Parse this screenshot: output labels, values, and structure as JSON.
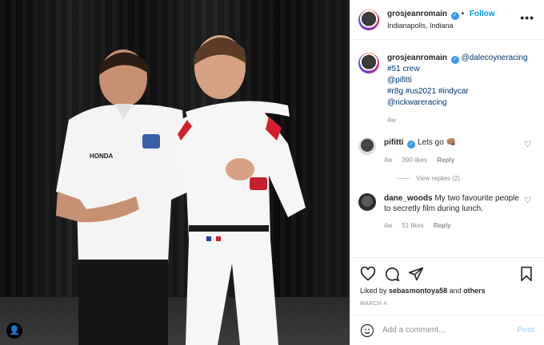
{
  "post": {
    "author": "grosjeanromain",
    "follow_label": "Follow",
    "location": "Indianapolis, Indiana",
    "more_label": "•••"
  },
  "caption": {
    "author": "grosjeanromain",
    "mention": "@dalecoyneracing",
    "line2": "#51 crew",
    "line3": "@pifitti",
    "line4": "#r8g #us2021 #indycar",
    "line5": "@rickwareracing",
    "time": "4w"
  },
  "comments": [
    {
      "user": "pifitti",
      "text": "Lets go 👊🏽",
      "time": "4w",
      "likes": "390 likes",
      "reply": "Reply",
      "view_replies": "View replies (2)"
    },
    {
      "user": "dane_woods",
      "text": "My two favourite people to secretly film during lunch.",
      "time": "4w",
      "likes": "51 likes",
      "reply": "Reply"
    }
  ],
  "actions": {
    "liked_prefix": "Liked by",
    "liked_user": "sebasmontoya58",
    "liked_suffix": "and",
    "liked_others": "others",
    "date": "MARCH 4"
  },
  "add_comment": {
    "placeholder": "Add a comment...",
    "post_label": "Post"
  },
  "colors": {
    "link": "#00376b",
    "accent": "#0095f6",
    "verified": "#3897f0"
  }
}
